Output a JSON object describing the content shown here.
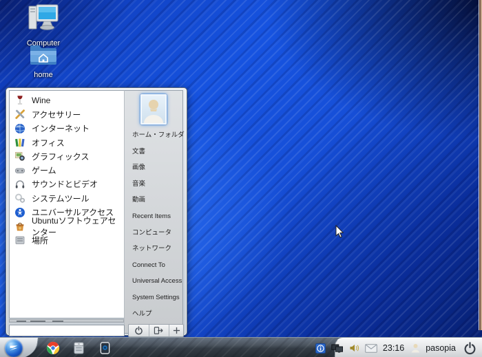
{
  "desktop": {
    "icons": [
      {
        "label": "Computer"
      },
      {
        "label": "home"
      }
    ]
  },
  "start_menu": {
    "apps": [
      {
        "label": "Wine",
        "icon": "wine-glass-icon"
      },
      {
        "label": "アクセサリー",
        "icon": "accessories-icon"
      },
      {
        "label": "インターネット",
        "icon": "internet-globe-icon"
      },
      {
        "label": "オフィス",
        "icon": "office-books-icon"
      },
      {
        "label": "グラフィックス",
        "icon": "graphics-photos-icon"
      },
      {
        "label": "ゲーム",
        "icon": "games-gamepad-icon"
      },
      {
        "label": "サウンドとビデオ",
        "icon": "sound-video-headphones-icon"
      },
      {
        "label": "システムツール",
        "icon": "system-tools-icon"
      },
      {
        "label": "ユニバーサルアクセス",
        "icon": "universal-access-icon"
      },
      {
        "label": "Ubuntuソフトウェアセンター",
        "icon": "software-center-bag-icon"
      },
      {
        "label": "場所",
        "icon": "places-drawer-icon"
      }
    ],
    "places": [
      {
        "label": "ホーム・フォルダ"
      },
      {
        "label": "文書"
      },
      {
        "label": "画像"
      },
      {
        "label": "音楽"
      },
      {
        "label": "動画"
      },
      {
        "label": "Recent Items"
      },
      {
        "label": "コンピュータ"
      },
      {
        "label": "ネットワーク"
      },
      {
        "label": "Connect To"
      },
      {
        "label": "Universal Access"
      },
      {
        "label": "System Settings"
      },
      {
        "label": "ヘルプ"
      }
    ],
    "search": {
      "value": "",
      "placeholder": ""
    },
    "footer_icons": [
      "power-icon",
      "logout-icon",
      "plus-icon"
    ]
  },
  "taskbar": {
    "start_icon": "zorin-start-orb",
    "app_icons": [
      "chrome-icon",
      "file-manager-icon",
      "media-device-icon"
    ],
    "tray_icons": [
      "input-method-icon",
      "displays-icon",
      "volume-icon",
      "mail-icon",
      "user-icon",
      "power-icon"
    ],
    "clock": "23:16",
    "username": "pasopia"
  },
  "colors": {
    "wallpaper_blue": "#1653e0",
    "wallpaper_dark": "#071f6e",
    "taskbar_dark": "#343c45",
    "tray_light": "#e2e4e6",
    "menu_gray": "#d2d5d8",
    "accent_avatar_glow": "#3c8ce6"
  }
}
